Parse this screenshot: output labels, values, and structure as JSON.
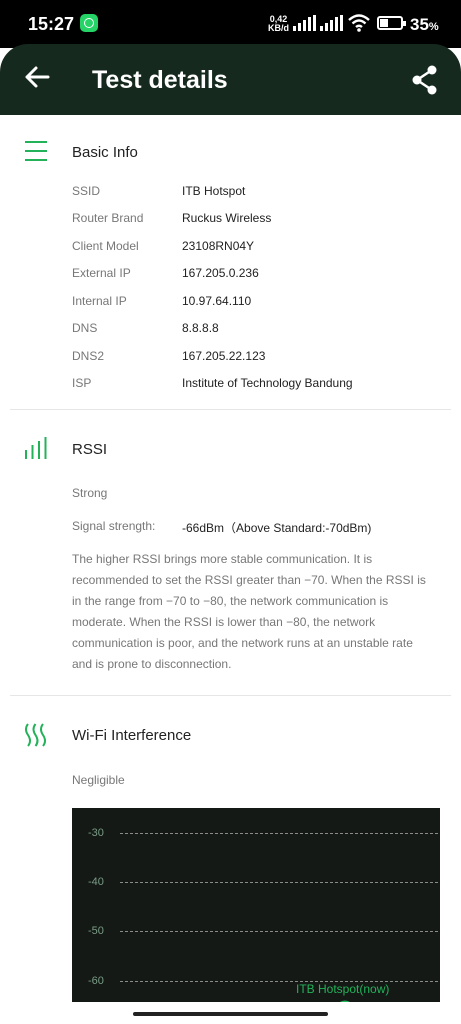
{
  "status_bar": {
    "time": "15:27",
    "net_speed_value": "0,42",
    "net_speed_unit": "KB/d",
    "battery": "35",
    "battery_unit": "%"
  },
  "header": {
    "title": "Test details"
  },
  "basic_info": {
    "title": "Basic Info",
    "rows": [
      {
        "label": "SSID",
        "value": "ITB Hotspot"
      },
      {
        "label": "Router Brand",
        "value": "Ruckus Wireless"
      },
      {
        "label": "Client Model",
        "value": "23108RN04Y"
      },
      {
        "label": "External IP",
        "value": "167.205.0.236"
      },
      {
        "label": "Internal IP",
        "value": "10.97.64.110"
      },
      {
        "label": "DNS",
        "value": "8.8.8.8"
      },
      {
        "label": "DNS2",
        "value": "167.205.22.123"
      },
      {
        "label": "ISP",
        "value": "Institute of Technology Bandung"
      }
    ]
  },
  "rssi": {
    "title": "RSSI",
    "status": "Strong",
    "signal_label": "Signal strength:",
    "signal_value": "-66dBm（Above Standard:-70dBm)",
    "description": "The higher RSSI brings more stable communication. It is recommended to set the RSSI greater than −70. When the RSSI is in the range from −70 to −80, the network communication is moderate. When the RSSI is lower than −80, the network communication is poor, and the network runs at an unstable rate and is prone to disconnection."
  },
  "interference": {
    "title": "Wi-Fi Interference",
    "status": "Negligible"
  },
  "chart_data": {
    "type": "line",
    "y_ticks": [
      "-30",
      "-40",
      "-50",
      "-60"
    ],
    "grid": true,
    "series": [
      {
        "name": "ITB Hotspot(now)"
      }
    ]
  },
  "colors": {
    "accent": "#23b25a",
    "header_bg": "#16291e",
    "chart_bg": "#141915"
  }
}
